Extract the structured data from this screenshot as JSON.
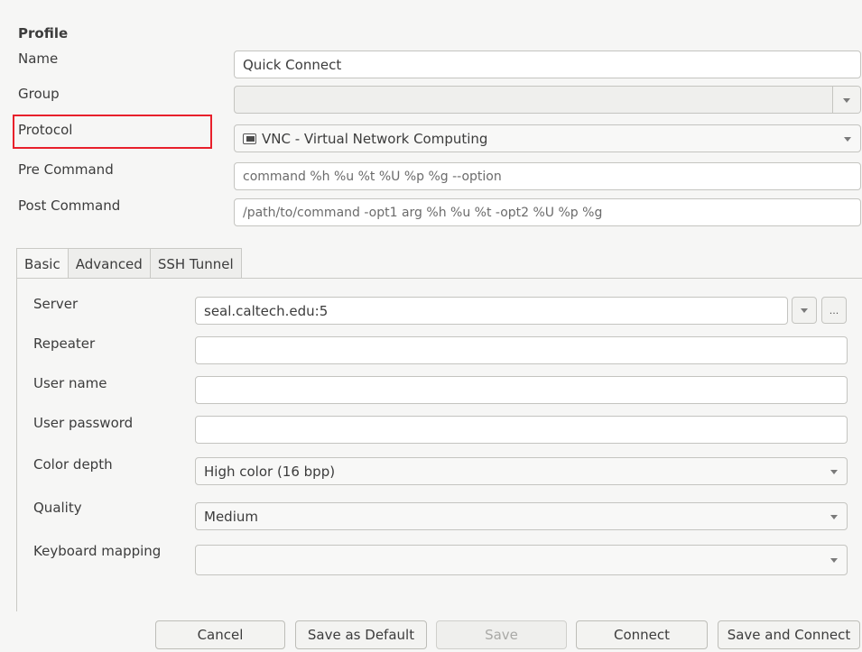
{
  "profile": {
    "section_title": "Profile",
    "name_label": "Name",
    "name_value": "Quick Connect",
    "group_label": "Group",
    "group_value": "",
    "protocol_label": "Protocol",
    "protocol_value": "VNC - Virtual Network Computing",
    "protocol_icon": "vnc-icon",
    "precommand_label": "Pre Command",
    "precommand_placeholder": "command %h %u %t %U %p %g --option",
    "postcommand_label": "Post Command",
    "postcommand_placeholder": "/path/to/command -opt1 arg %h %u %t -opt2 %U %p %g"
  },
  "tabs": [
    {
      "label": "Basic"
    },
    {
      "label": "Advanced"
    },
    {
      "label": "SSH Tunnel"
    }
  ],
  "basic": {
    "server_label": "Server",
    "server_value": "seal.caltech.edu:5",
    "server_browse_label": "...",
    "repeater_label": "Repeater",
    "repeater_value": "",
    "username_label": "User name",
    "username_value": "",
    "password_label": "User password",
    "password_value": "",
    "colordepth_label": "Color depth",
    "colordepth_value": "High color (16 bpp)",
    "quality_label": "Quality",
    "quality_value": "Medium",
    "keymap_label": "Keyboard mapping",
    "keymap_value": ""
  },
  "buttons": {
    "cancel": "Cancel",
    "save_default": "Save as Default",
    "save": "Save",
    "connect": "Connect",
    "save_connect": "Save and Connect"
  },
  "colors": {
    "highlight": "#e8202b",
    "background": "#f6f6f5"
  }
}
